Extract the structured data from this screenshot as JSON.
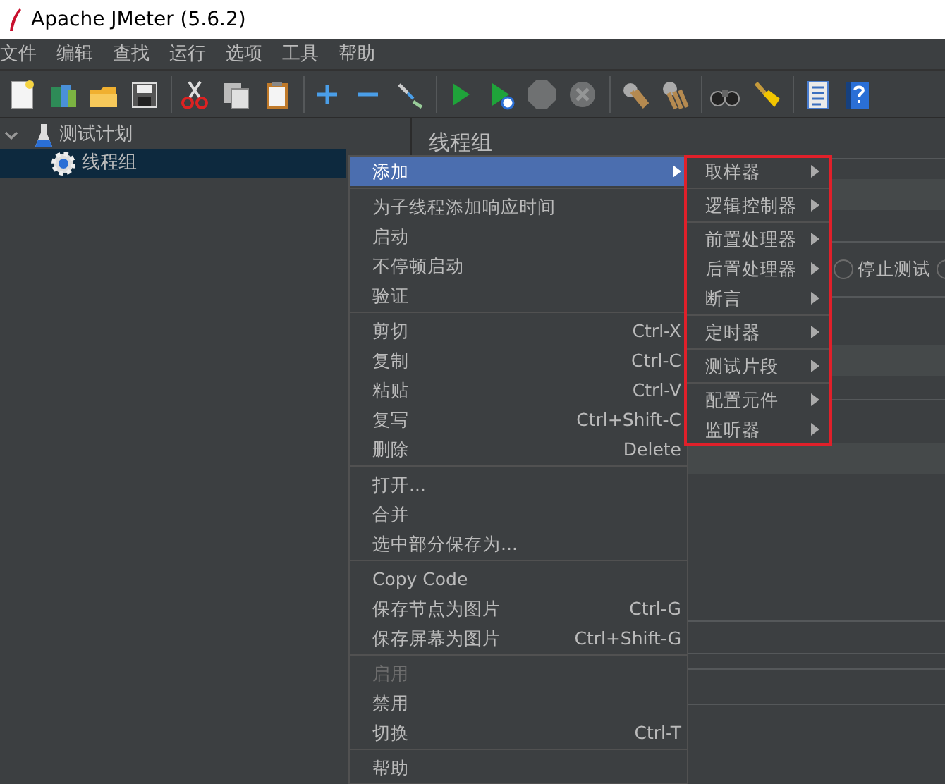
{
  "window": {
    "title": "Apache JMeter (5.6.2)"
  },
  "menubar": [
    "文件",
    "编辑",
    "查找",
    "运行",
    "选项",
    "工具",
    "帮助"
  ],
  "toolbar": [
    {
      "kind": "new",
      "disabled": false
    },
    {
      "kind": "templates",
      "disabled": false
    },
    {
      "kind": "open",
      "disabled": false
    },
    {
      "kind": "save",
      "disabled": false
    },
    {
      "kind": "separator"
    },
    {
      "kind": "cut",
      "disabled": false
    },
    {
      "kind": "copy",
      "disabled": false
    },
    {
      "kind": "paste",
      "disabled": false
    },
    {
      "kind": "separator"
    },
    {
      "kind": "expand",
      "disabled": false
    },
    {
      "kind": "collapse",
      "disabled": false
    },
    {
      "kind": "toggle",
      "disabled": false
    },
    {
      "kind": "separator"
    },
    {
      "kind": "start",
      "disabled": false
    },
    {
      "kind": "start_no_pause",
      "disabled": false
    },
    {
      "kind": "stop",
      "disabled": true
    },
    {
      "kind": "shutdown",
      "disabled": true
    },
    {
      "kind": "separator"
    },
    {
      "kind": "clear",
      "disabled": false
    },
    {
      "kind": "clear_all",
      "disabled": false
    },
    {
      "kind": "separator"
    },
    {
      "kind": "search",
      "disabled": false
    },
    {
      "kind": "reset_search",
      "disabled": false
    },
    {
      "kind": "separator"
    },
    {
      "kind": "functions",
      "disabled": false
    },
    {
      "kind": "help",
      "disabled": false
    }
  ],
  "tree": [
    {
      "label": "测试计划",
      "expanded": true,
      "selected": false,
      "children": [
        {
          "label": "线程组",
          "selected": true
        }
      ]
    }
  ],
  "panel": {
    "title": "线程组",
    "radio_options": [
      {
        "label": "停止测试",
        "selected": false
      },
      {
        "selected": false
      }
    ]
  },
  "context_menu": {
    "items": [
      {
        "kind": "item",
        "label": "添加",
        "has_submenu": true,
        "highlighted": true,
        "disabled": false
      },
      {
        "kind": "separator"
      },
      {
        "kind": "item",
        "label": "为子线程添加响应时间",
        "highlighted": false,
        "disabled": false
      },
      {
        "kind": "item",
        "label": "启动",
        "highlighted": false,
        "disabled": false
      },
      {
        "kind": "item",
        "label": "不停顿启动",
        "highlighted": false,
        "disabled": false
      },
      {
        "kind": "item",
        "label": "验证",
        "highlighted": false,
        "disabled": false
      },
      {
        "kind": "separator"
      },
      {
        "kind": "item",
        "label": "剪切",
        "shortcut": "Ctrl-X",
        "highlighted": false,
        "disabled": false
      },
      {
        "kind": "item",
        "label": "复制",
        "shortcut": "Ctrl-C",
        "highlighted": false,
        "disabled": false
      },
      {
        "kind": "item",
        "label": "粘贴",
        "shortcut": "Ctrl-V",
        "highlighted": false,
        "disabled": false
      },
      {
        "kind": "item",
        "label": "复写",
        "shortcut": "Ctrl+Shift-C",
        "highlighted": false,
        "disabled": false
      },
      {
        "kind": "item",
        "label": "删除",
        "shortcut": "Delete",
        "highlighted": false,
        "disabled": false
      },
      {
        "kind": "separator"
      },
      {
        "kind": "item",
        "label": "打开...",
        "highlighted": false,
        "disabled": false
      },
      {
        "kind": "item",
        "label": "合并",
        "highlighted": false,
        "disabled": false
      },
      {
        "kind": "item",
        "label": "选中部分保存为...",
        "highlighted": false,
        "disabled": false
      },
      {
        "kind": "separator"
      },
      {
        "kind": "item",
        "label": "Copy Code",
        "highlighted": false,
        "disabled": false
      },
      {
        "kind": "item",
        "label": "保存节点为图片",
        "shortcut": "Ctrl-G",
        "highlighted": false,
        "disabled": false
      },
      {
        "kind": "item",
        "label": "保存屏幕为图片",
        "shortcut": "Ctrl+Shift-G",
        "highlighted": false,
        "disabled": false
      },
      {
        "kind": "separator"
      },
      {
        "kind": "item",
        "label": "启用",
        "highlighted": false,
        "disabled": true
      },
      {
        "kind": "item",
        "label": "禁用",
        "highlighted": false,
        "disabled": false
      },
      {
        "kind": "item",
        "label": "切换",
        "shortcut": "Ctrl-T",
        "highlighted": false,
        "disabled": false
      },
      {
        "kind": "separator"
      },
      {
        "kind": "item",
        "label": "帮助",
        "highlighted": false,
        "disabled": false
      }
    ]
  },
  "submenu": {
    "outlined": true,
    "items": [
      {
        "kind": "item",
        "label": "取样器",
        "has_submenu": true
      },
      {
        "kind": "separator"
      },
      {
        "kind": "item",
        "label": "逻辑控制器",
        "has_submenu": true
      },
      {
        "kind": "separator"
      },
      {
        "kind": "item",
        "label": "前置处理器",
        "has_submenu": true
      },
      {
        "kind": "item",
        "label": "后置处理器",
        "has_submenu": true
      },
      {
        "kind": "item",
        "label": "断言",
        "has_submenu": true
      },
      {
        "kind": "separator"
      },
      {
        "kind": "item",
        "label": "定时器",
        "has_submenu": true
      },
      {
        "kind": "separator"
      },
      {
        "kind": "item",
        "label": "测试片段",
        "has_submenu": true
      },
      {
        "kind": "separator"
      },
      {
        "kind": "item",
        "label": "配置元件",
        "has_submenu": true
      },
      {
        "kind": "item",
        "label": "监听器",
        "has_submenu": true
      }
    ]
  }
}
